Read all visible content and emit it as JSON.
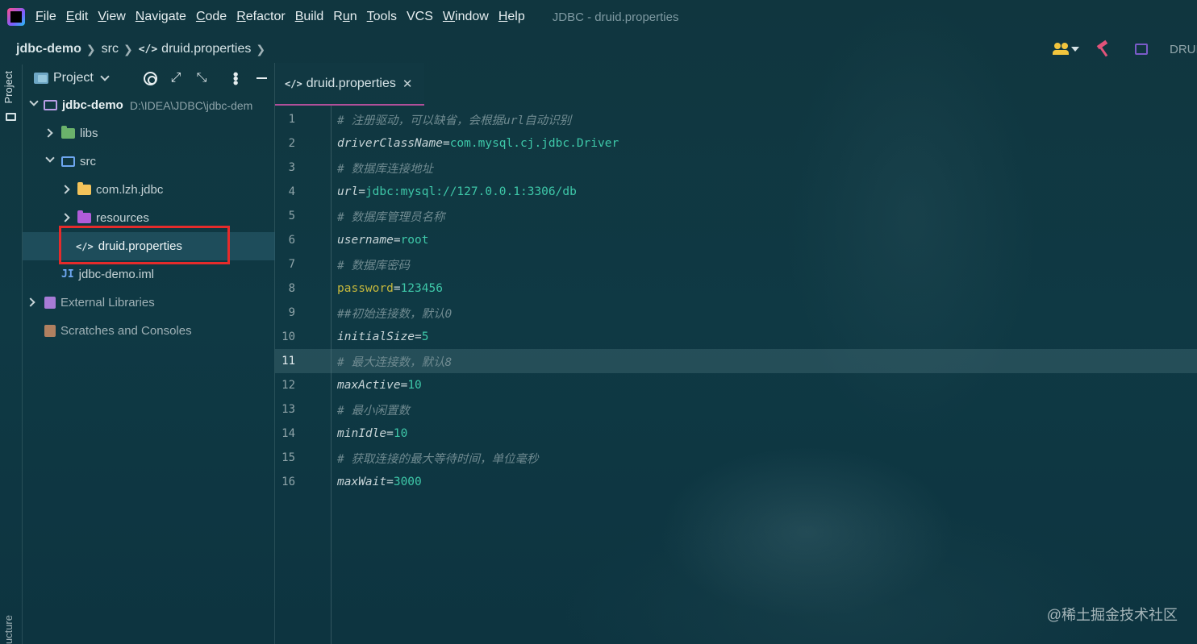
{
  "menubar": {
    "items": [
      {
        "label": "File",
        "mnemonic": "F",
        "rest": "ile"
      },
      {
        "label": "Edit",
        "mnemonic": "E",
        "rest": "dit"
      },
      {
        "label": "View",
        "mnemonic": "V",
        "rest": "iew"
      },
      {
        "label": "Navigate",
        "mnemonic": "N",
        "rest": "avigate"
      },
      {
        "label": "Code",
        "mnemonic": "C",
        "rest": "ode"
      },
      {
        "label": "Refactor",
        "mnemonic": "R",
        "rest": "efactor"
      },
      {
        "label": "Build",
        "mnemonic": "B",
        "rest": "uild"
      },
      {
        "label": "Run",
        "mnemonic": "R",
        "rest": "un",
        "prefix": "",
        "underline_index": 1
      },
      {
        "label": "Tools",
        "mnemonic": "T",
        "rest": "ools"
      },
      {
        "label": "VCS",
        "mnemonic": "",
        "rest": "VCS"
      },
      {
        "label": "Window",
        "mnemonic": "W",
        "rest": "indow"
      },
      {
        "label": "Help",
        "mnemonic": "H",
        "rest": "elp"
      }
    ],
    "window_title": "JDBC - druid.properties"
  },
  "breadcrumb": {
    "project": "jdbc-demo",
    "folder": "src",
    "file": "druid.properties"
  },
  "toolbar": {
    "run_config_label": "DRUI"
  },
  "tool_strip": {
    "project_tab": "Project",
    "structure_tab": "ucture"
  },
  "project_panel": {
    "title": "Project",
    "tree": [
      {
        "label": "jdbc-demo",
        "path": "D:\\IDEA\\JDBC\\jdbc-dem",
        "icon": "module-folder-icon",
        "expanded": true
      },
      {
        "label": "libs",
        "icon": "library-folder-icon",
        "expanded": false
      },
      {
        "label": "src",
        "icon": "source-folder-icon",
        "expanded": true
      },
      {
        "label": "com.lzh.jdbc",
        "icon": "package-folder-icon",
        "expanded": false
      },
      {
        "label": "resources",
        "icon": "resources-folder-icon",
        "expanded": false
      },
      {
        "label": "druid.properties",
        "icon": "properties-file-icon",
        "selected": true
      },
      {
        "label": "jdbc-demo.iml",
        "icon": "iml-file-icon"
      },
      {
        "label": "External Libraries",
        "icon": "external-libraries-icon",
        "expanded": false
      },
      {
        "label": "Scratches and Consoles",
        "icon": "scratches-icon"
      }
    ]
  },
  "editor": {
    "tab_label": "druid.properties",
    "current_line": 11,
    "lines": [
      {
        "n": "1",
        "comment": "# 注册驱动，可以缺省，会根据url自动识别"
      },
      {
        "n": "2",
        "key": "driverClassName",
        "value": "com.mysql.cj.jdbc.Driver"
      },
      {
        "n": "3",
        "comment": "# 数据库连接地址"
      },
      {
        "n": "4",
        "key": "url",
        "value": "jdbc:mysql://127.0.0.1:3306/db"
      },
      {
        "n": "5",
        "comment": "# 数据库管理员名称"
      },
      {
        "n": "6",
        "key": "username",
        "value": "root"
      },
      {
        "n": "7",
        "comment": "# 数据库密码"
      },
      {
        "n": "8",
        "key": "password",
        "value": "123456"
      },
      {
        "n": "9",
        "comment": "##初始连接数，默认0"
      },
      {
        "n": "10",
        "key": "initialSize",
        "value": "5"
      },
      {
        "n": "11",
        "comment": "# 最大连接数，默认8"
      },
      {
        "n": "12",
        "key": "maxActive",
        "value": "10"
      },
      {
        "n": "13",
        "comment": "# 最小闲置数"
      },
      {
        "n": "14",
        "key": "minIdle",
        "value": "10"
      },
      {
        "n": "15",
        "comment": "# 获取连接的最大等待时间，单位毫秒"
      },
      {
        "n": "16",
        "key": "maxWait",
        "value": "3000"
      }
    ]
  },
  "watermark": "@稀土掘金技术社区",
  "colors": {
    "highlight_box": "#e52b2b",
    "tab_underline": "#b14f9a",
    "value_text": "#3ec7a8",
    "password_key": "#c7b93c"
  }
}
